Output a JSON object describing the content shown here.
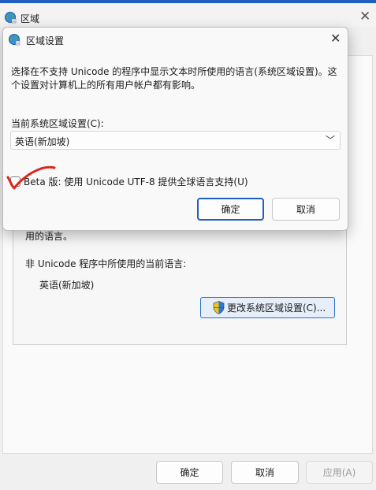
{
  "parent": {
    "title": "区域",
    "lang_desc": "用的语言。",
    "nonunicode_label": "非 Unicode 程序中所使用的当前语言:",
    "nonunicode_value": "英语(新加坡)",
    "change_button": "更改系统区域设置(C)...",
    "ok": "确定",
    "cancel": "取消",
    "apply": "应用(A)"
  },
  "dialog": {
    "title": "区域设置",
    "desc": "选择在不支持 Unicode 的程序中显示文本时所使用的语言(系统区域设置)。这个设置对计算机上的所有用户帐户都有影响。",
    "current_label": "当前系统区域设置(C):",
    "current_value": "英语(新加坡)",
    "beta_label": "Beta 版: 使用 Unicode UTF-8 提供全球语言支持(U)",
    "beta_checked": false,
    "ok": "确定",
    "cancel": "取消"
  },
  "colors": {
    "accent": "#1f5fbf",
    "annotation": "#e0241b"
  },
  "icons": {
    "window": "globe-icon",
    "shield": "uac-shield-icon"
  }
}
